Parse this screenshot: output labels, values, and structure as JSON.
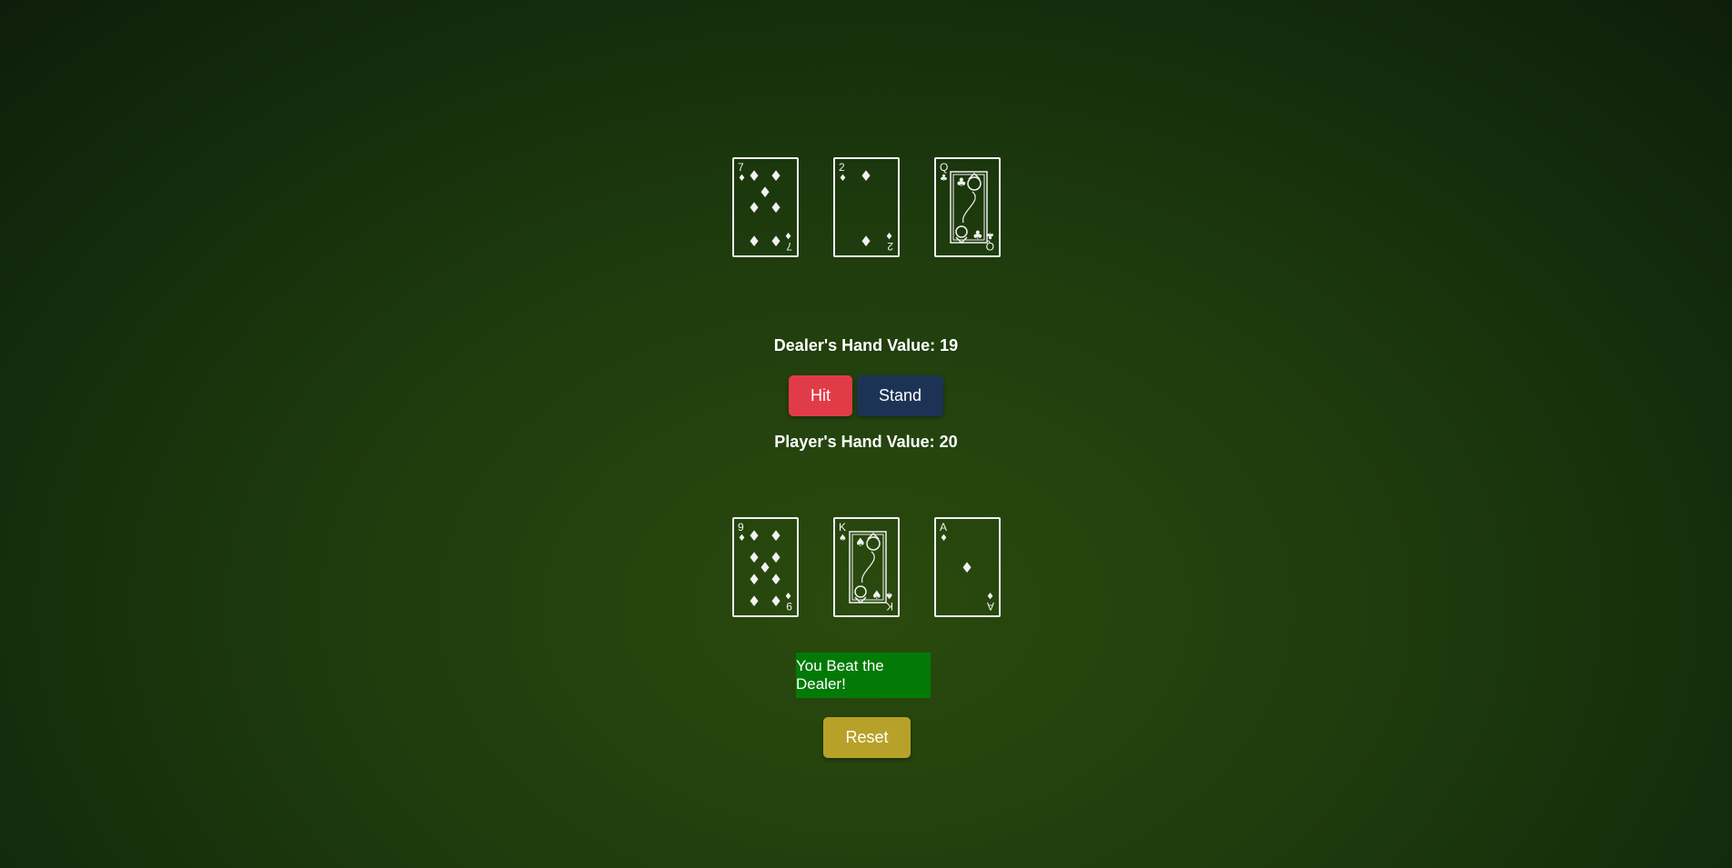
{
  "dealer": {
    "value_label": "Dealer's Hand Value: 19",
    "cards": [
      {
        "rank": "7",
        "suit": "diamonds",
        "suit_symbol": "♦"
      },
      {
        "rank": "2",
        "suit": "diamonds",
        "suit_symbol": "♦"
      },
      {
        "rank": "Q",
        "suit": "clubs",
        "suit_symbol": "♣"
      }
    ]
  },
  "player": {
    "value_label": "Player's Hand Value: 20",
    "cards": [
      {
        "rank": "9",
        "suit": "diamonds",
        "suit_symbol": "♦"
      },
      {
        "rank": "K",
        "suit": "spades",
        "suit_symbol": "♠"
      },
      {
        "rank": "A",
        "suit": "diamonds",
        "suit_symbol": "♦"
      }
    ]
  },
  "controls": {
    "hit_label": "Hit",
    "stand_label": "Stand",
    "reset_label": "Reset"
  },
  "result": {
    "message": "You Beat the Dealer!"
  },
  "colors": {
    "hit": "#e23b48",
    "stand": "#1d3355",
    "reset": "#b8a128",
    "result": "#047a06",
    "card_outline": "#f2f2f2"
  }
}
